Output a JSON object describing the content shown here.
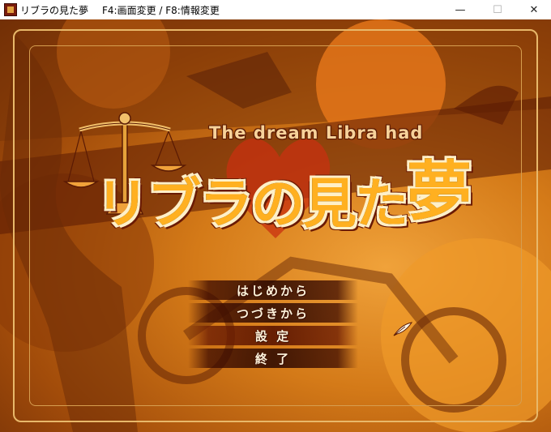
{
  "window": {
    "title": "リブラの見た夢",
    "hint": "F4:画面変更 / F8:情報変更",
    "minimize_glyph": "—",
    "maximize_glyph": "☐",
    "close_glyph": "✕"
  },
  "game": {
    "subtitle": "The dream Libra had",
    "logo_main": "リブラの見た",
    "logo_last": "夢",
    "menu": [
      {
        "label": "はじめから"
      },
      {
        "label": "つづきから"
      },
      {
        "label": "設 定"
      },
      {
        "label": "終 了"
      }
    ],
    "cursor_icon": "quill-pen-icon"
  },
  "colors": {
    "accent": "#ffb020",
    "frame": "#e8b86a",
    "menu_text": "#fff4dc"
  }
}
